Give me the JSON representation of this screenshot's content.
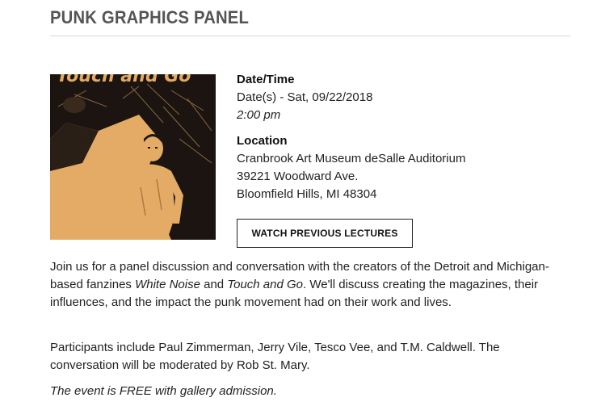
{
  "event": {
    "title": "PUNK GRAPHICS PANEL",
    "date_label": "Date/Time",
    "date_value": "Date(s) - Sat, 09/22/2018",
    "time_value": "2:00 pm",
    "location_label": "Location",
    "location_lines": [
      "Cranbrook Art Museum deSalle Auditorium",
      "39221 Woodward Ave.",
      "Bloomfield Hills, MI 48304"
    ],
    "button_label": "WATCH PREVIOUS LECTURES",
    "poster_text": "Touch and Go"
  },
  "description": {
    "p1_part1": "Join us for a panel discussion and conversation with the creators of the Detroit and Michigan-based fanzines ",
    "p1_em1": "White Noise",
    "p1_part2": " and ",
    "p1_em2": "Touch and Go",
    "p1_part3": ". We'll discuss creating the magazines, their influences, and the impact the punk movement had on their work and lives.",
    "p2": "Participants include Paul Zimmerman, Jerry Vile, Tesco Vee, and T.M. Caldwell. The conversation will be moderated by Rob St. Mary.",
    "p3": "The event is FREE with gallery admission."
  }
}
